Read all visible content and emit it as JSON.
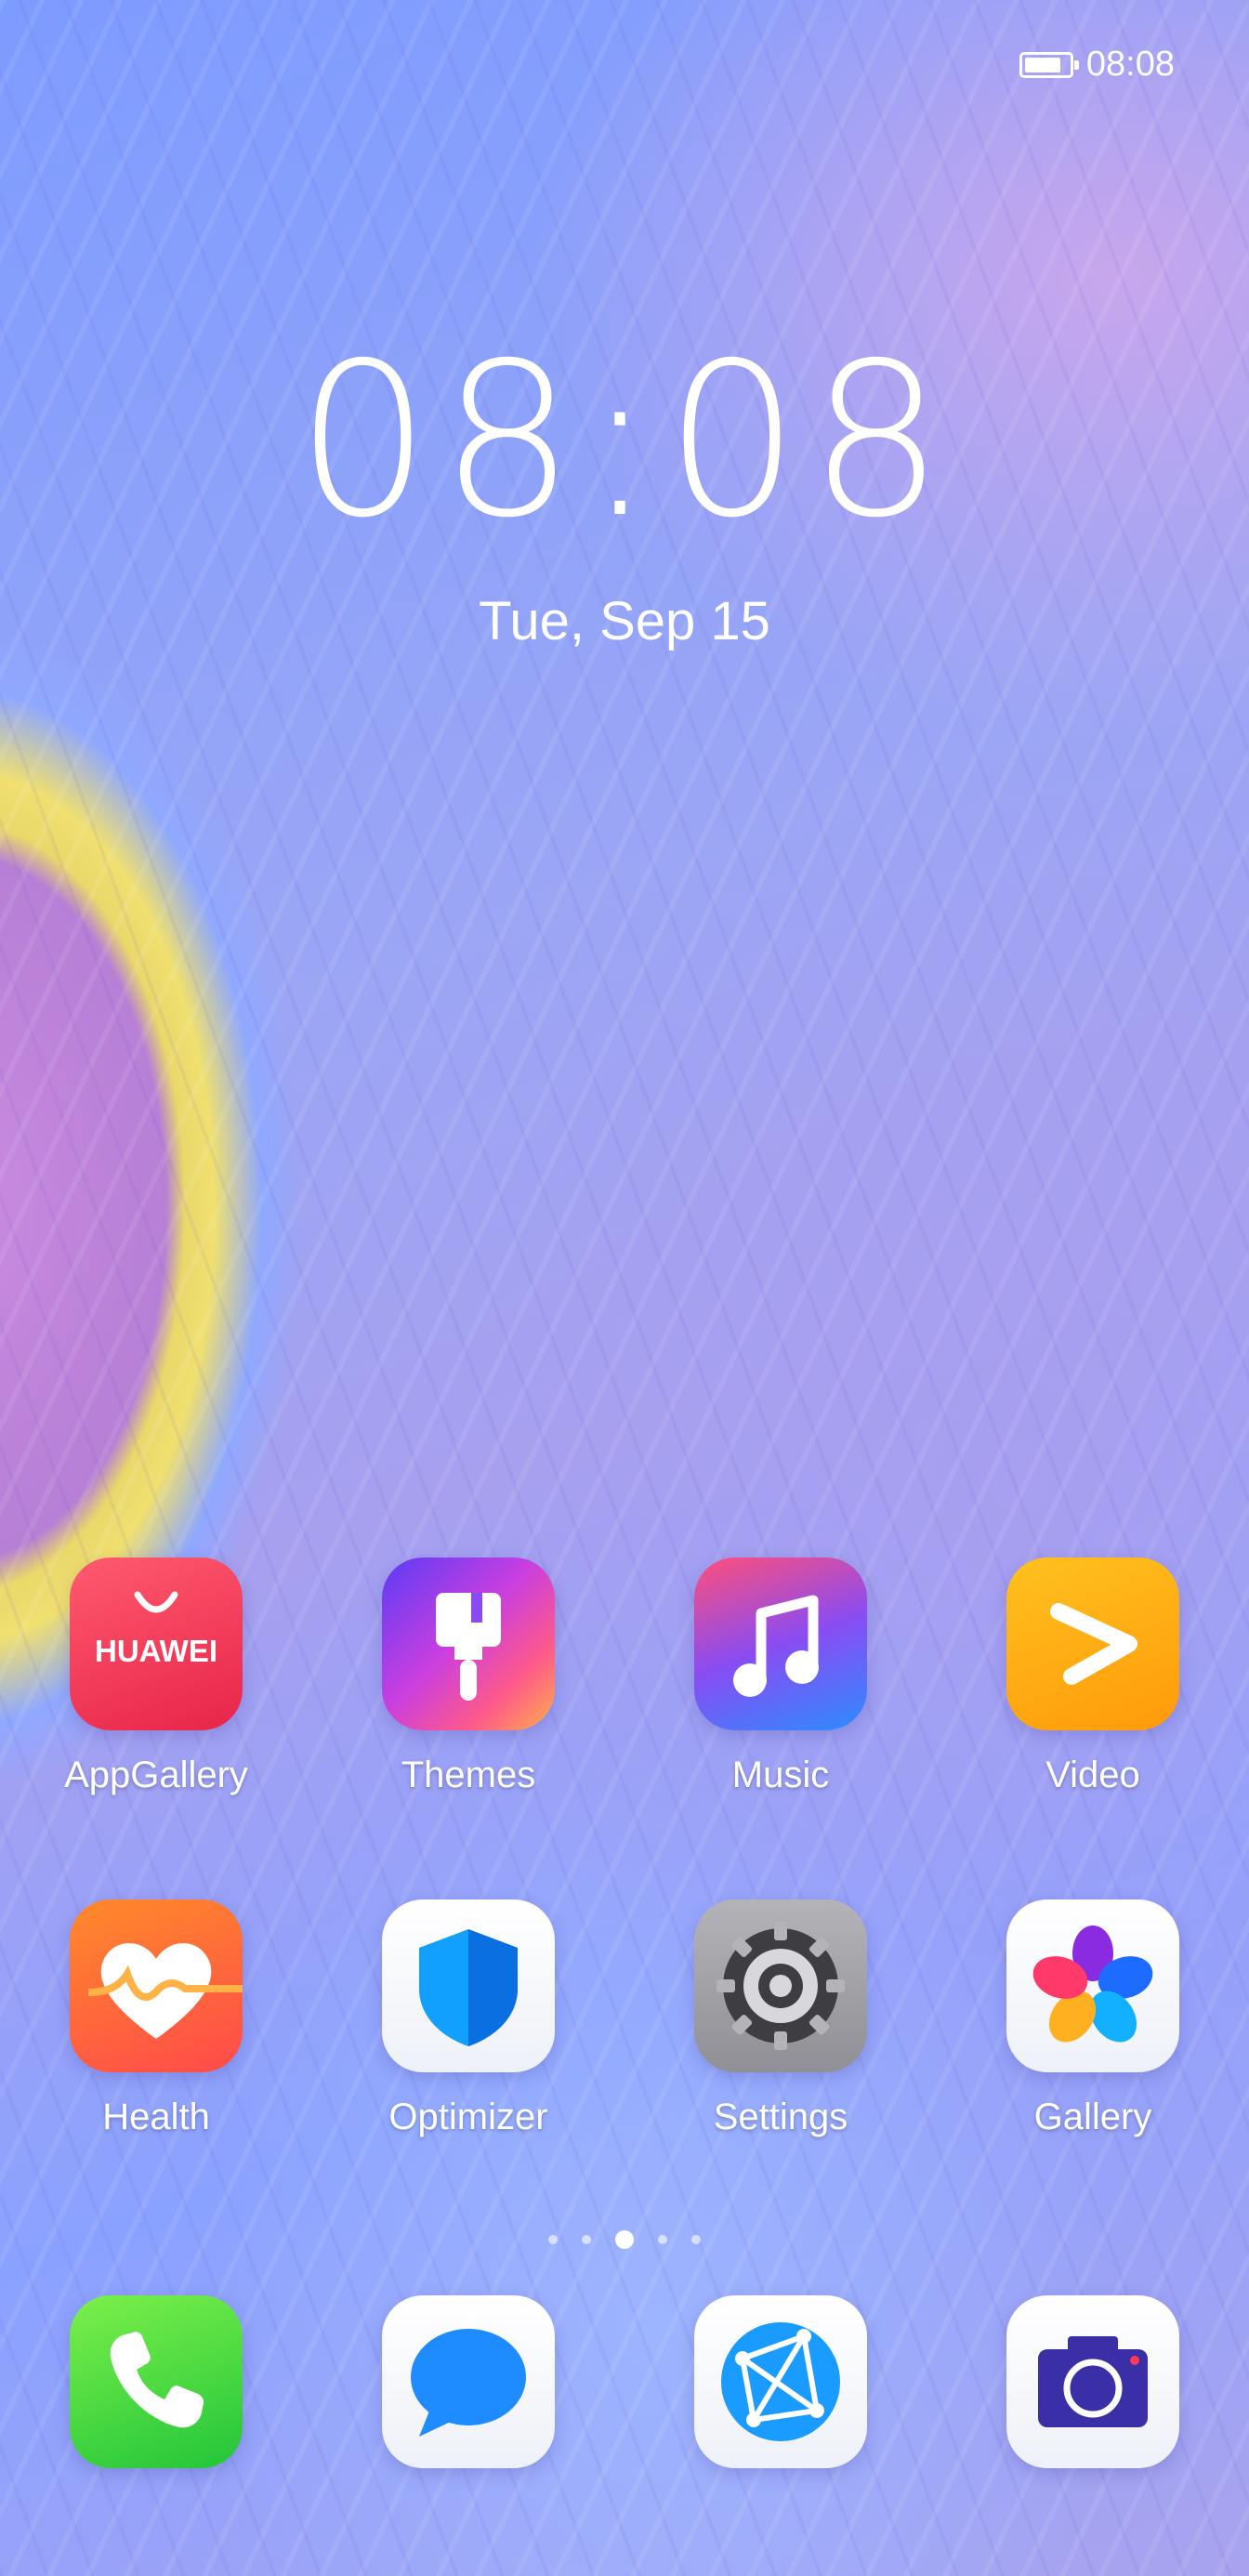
{
  "status_bar": {
    "time": "08:08",
    "battery_icon": "battery-icon",
    "battery_level": 0.85
  },
  "lockclock": {
    "time": "08:08",
    "date": "Tue, Sep 15"
  },
  "apps_row1": [
    {
      "label": "AppGallery",
      "icon": "appgallery-icon",
      "icon_text": "HUAWEI"
    },
    {
      "label": "Themes",
      "icon": "themes-brush-icon"
    },
    {
      "label": "Music",
      "icon": "music-note-icon"
    },
    {
      "label": "Video",
      "icon": "video-play-icon"
    }
  ],
  "apps_row2": [
    {
      "label": "Health",
      "icon": "health-heart-icon"
    },
    {
      "label": "Optimizer",
      "icon": "shield-icon"
    },
    {
      "label": "Settings",
      "icon": "gear-icon"
    },
    {
      "label": "Gallery",
      "icon": "gallery-flower-icon"
    }
  ],
  "dock": [
    {
      "name": "Phone",
      "icon": "phone-icon"
    },
    {
      "name": "Messaging",
      "icon": "message-bubble-icon"
    },
    {
      "name": "Browser",
      "icon": "browser-globe-icon"
    },
    {
      "name": "Camera",
      "icon": "camera-icon"
    }
  ],
  "page_indicator": {
    "pages": 5,
    "current": 3
  },
  "colors": {
    "appgallery": "#e8244a",
    "video": "#ff9a0a",
    "phone": "#22c53a",
    "messaging": "#1e8bff",
    "camera": "#3b2fa8"
  }
}
